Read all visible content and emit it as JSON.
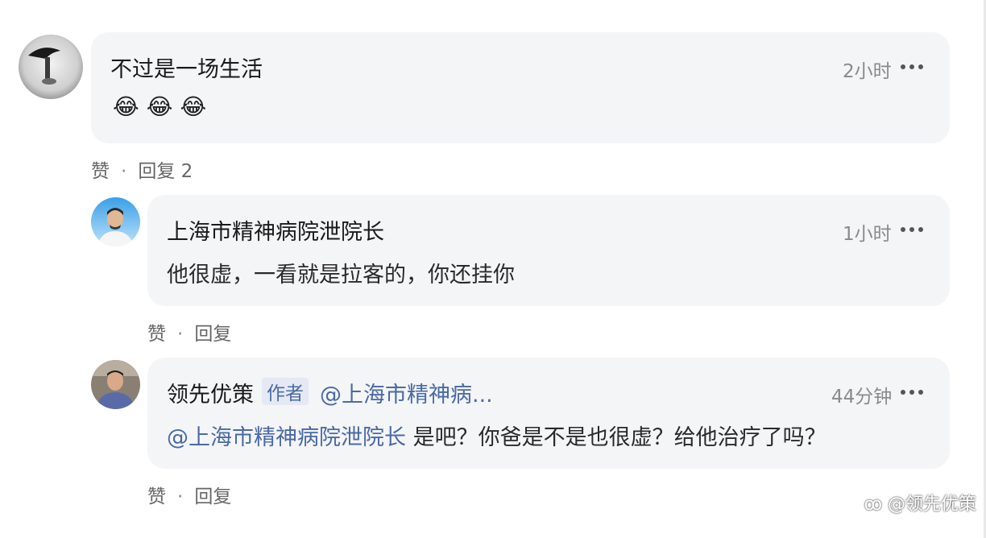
{
  "comments": [
    {
      "name": "不过是一场生活",
      "time": "2小时",
      "emojis": [
        "😂",
        "😂",
        "😂"
      ],
      "like_label": "赞",
      "reply_label": "回复 2"
    },
    {
      "name": "上海市精神病院泄院长",
      "time": "1小时",
      "text": "他很虚，一看就是拉客的，你还挂你",
      "like_label": "赞",
      "reply_label": "回复"
    },
    {
      "name": "领先优策",
      "author_tag": "作者",
      "reply_to": "@上海市精神病...",
      "time": "44分钟",
      "mention": "@上海市精神病院泄院长",
      "text": "是吧？你爸是不是也很虚？给他治疗了吗？",
      "like_label": "赞",
      "reply_label": "回复"
    }
  ],
  "separator": "·",
  "watermark": "@领先优策",
  "colors": {
    "bubble": "#f4f5f7",
    "mention": "#4a6aa5",
    "author_tag_bg": "#e4e9f3"
  }
}
